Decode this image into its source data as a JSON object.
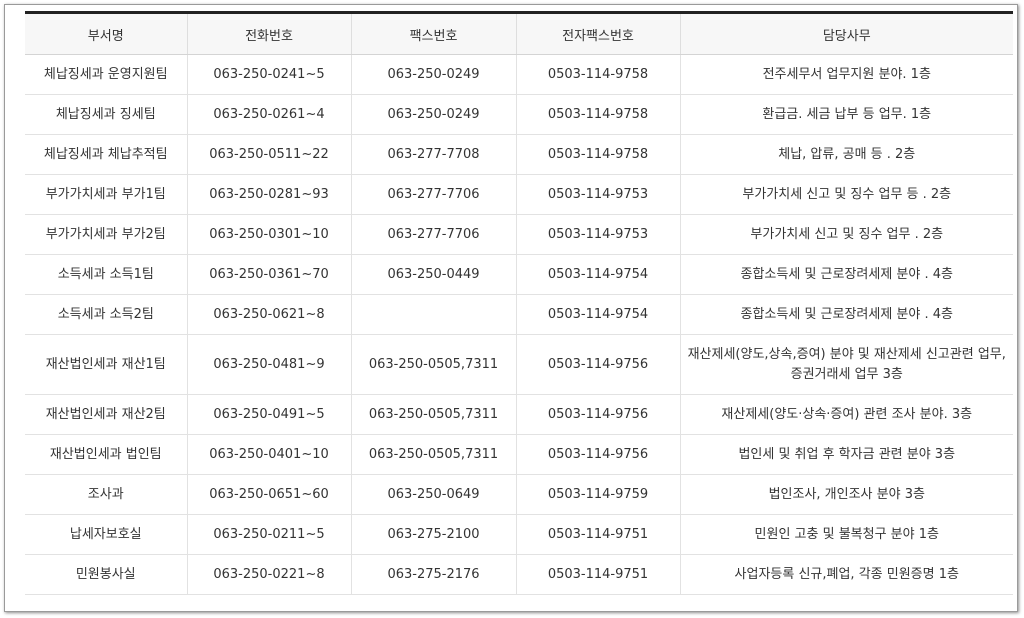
{
  "table": {
    "headers": [
      "부서명",
      "전화번호",
      "팩스번호",
      "전자팩스번호",
      "담당사무"
    ],
    "rows": [
      [
        "체납징세과 운영지원팀",
        "063-250-0241~5",
        "063-250-0249",
        "0503-114-9758",
        "전주세무서 업무지원 분야. 1층"
      ],
      [
        "체납징세과 징세팀",
        "063-250-0261~4",
        "063-250-0249",
        "0503-114-9758",
        "환급금. 세금 납부 등 업무. 1층"
      ],
      [
        "체납징세과 체납추적팀",
        "063-250-0511~22",
        "063-277-7708",
        "0503-114-9758",
        "체납, 압류, 공매 등 . 2층"
      ],
      [
        "부가가치세과 부가1팀",
        "063-250-0281~93",
        "063-277-7706",
        "0503-114-9753",
        "부가가치세 신고 및 징수 업무 등 . 2층"
      ],
      [
        "부가가치세과 부가2팀",
        "063-250-0301~10",
        "063-277-7706",
        "0503-114-9753",
        "부가가치세 신고 및 징수 업무 . 2층"
      ],
      [
        "소득세과 소득1팀",
        "063-250-0361~70",
        "063-250-0449",
        "0503-114-9754",
        "종합소득세 및 근로장려세제 분야 . 4층"
      ],
      [
        "소득세과 소득2팀",
        "063-250-0621~8",
        "",
        "0503-114-9754",
        "종합소득세 및 근로장려세제 분야 . 4층"
      ],
      [
        "재산법인세과 재산1팀",
        "063-250-0481~9",
        "063-250-0505,7311",
        "0503-114-9756",
        "재산제세(양도,상속,증여) 분야 및 재산제세 신고관련 업무, 증권거래세 업무 3층"
      ],
      [
        "재산법인세과 재산2팀",
        "063-250-0491~5",
        "063-250-0505,7311",
        "0503-114-9756",
        "재산제세(양도·상속·증여) 관련 조사 분야. 3층"
      ],
      [
        "재산법인세과 법인팀",
        "063-250-0401~10",
        "063-250-0505,7311",
        "0503-114-9756",
        "법인세 및 취업 후 학자금 관련 분야 3층"
      ],
      [
        "조사과",
        "063-250-0651~60",
        "063-250-0649",
        "0503-114-9759",
        "법인조사, 개인조사 분야 3층"
      ],
      [
        "납세자보호실",
        "063-250-0211~5",
        "063-275-2100",
        "0503-114-9751",
        "민원인 고충 및 불복청구 분야 1층"
      ],
      [
        "민원봉사실",
        "063-250-0221~8",
        "063-275-2176",
        "0503-114-9751",
        "사업자등록 신규,폐업, 각종 민원증명 1층"
      ]
    ]
  }
}
